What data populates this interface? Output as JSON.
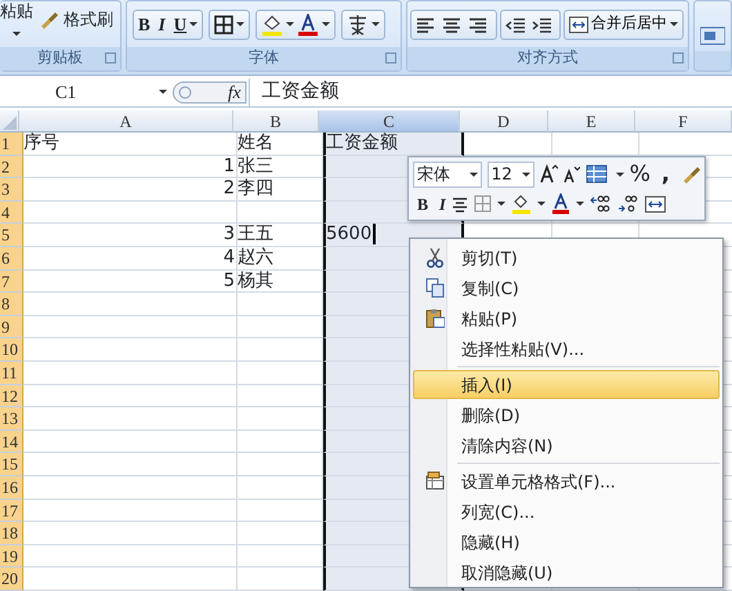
{
  "ribbon": {
    "clipboard": {
      "paste": "粘贴",
      "format_painter": "格式刷",
      "label": "剪贴板"
    },
    "font": {
      "bold": "B",
      "italic": "I",
      "underline": "U",
      "label": "字体"
    },
    "alignment": {
      "merge": "合并后居中",
      "label": "对齐方式"
    }
  },
  "formula_bar": {
    "name_box": "C1",
    "fx": "fx",
    "content": "工资金额"
  },
  "sheet": {
    "columns": [
      {
        "label": "A",
        "selected": false
      },
      {
        "label": "B",
        "selected": false
      },
      {
        "label": "C",
        "selected": true
      },
      {
        "label": "D",
        "selected": false
      },
      {
        "label": "E",
        "selected": false
      },
      {
        "label": "F",
        "selected": false
      }
    ],
    "rows": [
      {
        "label": "1",
        "selected": true,
        "cells": [
          {
            "text": "序号",
            "kind": "text"
          },
          {
            "text": "姓名",
            "kind": "text"
          },
          {
            "text": "工资金额",
            "kind": "text"
          }
        ]
      },
      {
        "label": "2",
        "selected": true,
        "cells": [
          {
            "text": "1",
            "kind": "number"
          },
          {
            "text": "张三",
            "kind": "text"
          }
        ]
      },
      {
        "label": "3",
        "selected": true,
        "cells": [
          {
            "text": "2",
            "kind": "number"
          },
          {
            "text": "李四",
            "kind": "text"
          }
        ]
      },
      {
        "label": "4",
        "selected": true
      },
      {
        "label": "5",
        "selected": true,
        "cells": [
          {
            "text": "3",
            "kind": "number"
          },
          {
            "text": "王五",
            "kind": "text"
          },
          {
            "text": "5600",
            "kind": "entry"
          }
        ]
      },
      {
        "label": "6",
        "selected": true,
        "cells": [
          {
            "text": "4",
            "kind": "number"
          },
          {
            "text": "赵六",
            "kind": "text"
          }
        ]
      },
      {
        "label": "7",
        "selected": true,
        "cells": [
          {
            "text": "5",
            "kind": "number"
          },
          {
            "text": "杨其",
            "kind": "text"
          }
        ]
      },
      {
        "label": "8",
        "selected": true
      },
      {
        "label": "9",
        "selected": true
      },
      {
        "label": "10",
        "selected": true
      },
      {
        "label": "11",
        "selected": true
      },
      {
        "label": "12",
        "selected": true
      },
      {
        "label": "13",
        "selected": true
      },
      {
        "label": "14",
        "selected": true
      },
      {
        "label": "15",
        "selected": true
      },
      {
        "label": "16",
        "selected": true
      },
      {
        "label": "17",
        "selected": true
      },
      {
        "label": "18",
        "selected": true
      },
      {
        "label": "19",
        "selected": true
      },
      {
        "label": "20",
        "selected": true
      }
    ]
  },
  "mini_toolbar": {
    "font": "宋体",
    "size": "12",
    "percent": "%",
    "comma": ",",
    "bold": "B",
    "italic": "I"
  },
  "context_menu": [
    {
      "label": "剪切(T)",
      "kind": "cut",
      "selected": false
    },
    {
      "label": "复制(C)",
      "kind": "copy",
      "selected": false
    },
    {
      "label": "粘贴(P)",
      "kind": "paste",
      "selected": false
    },
    {
      "label": "选择性粘贴(V)...",
      "kind": "plain",
      "selected": false
    },
    {
      "label": "插入(I)",
      "kind": "plain",
      "selected": true,
      "separator_before": true
    },
    {
      "label": "删除(D)",
      "kind": "plain",
      "selected": false
    },
    {
      "label": "清除内容(N)",
      "kind": "plain",
      "selected": false
    },
    {
      "label": "设置单元格格式(F)...",
      "kind": "format",
      "selected": false,
      "separator_before": true
    },
    {
      "label": "列宽(C)...",
      "kind": "plain",
      "selected": false
    },
    {
      "label": "隐藏(H)",
      "kind": "plain",
      "selected": false
    },
    {
      "label": "取消隐藏(U)",
      "kind": "plain",
      "selected": false
    }
  ]
}
